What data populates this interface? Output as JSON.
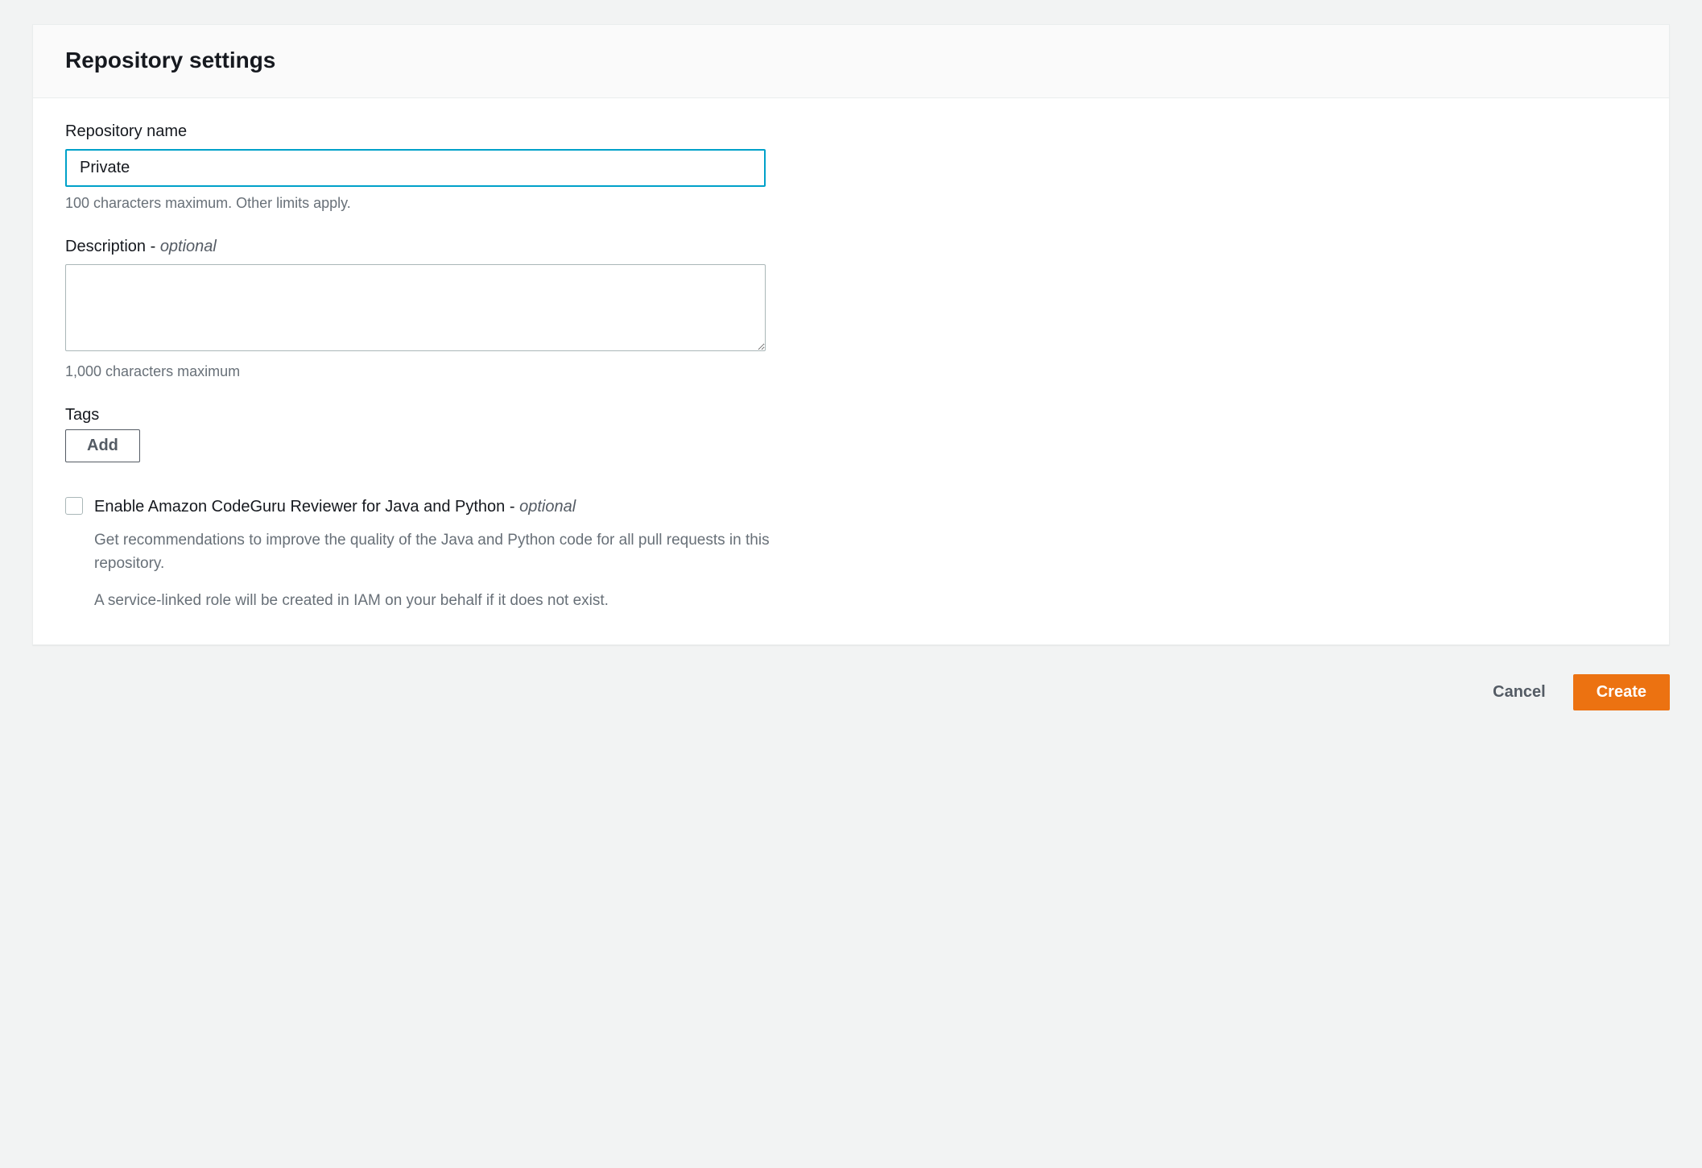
{
  "panel": {
    "title": "Repository settings"
  },
  "repositoryName": {
    "label": "Repository name",
    "value": "Private",
    "help": "100 characters maximum. Other limits apply."
  },
  "description": {
    "label": "Description - ",
    "optional": "optional",
    "value": "",
    "help": "1,000 characters maximum"
  },
  "tags": {
    "label": "Tags",
    "addButton": "Add"
  },
  "codeguru": {
    "label": "Enable Amazon CodeGuru Reviewer for Java and Python - ",
    "optional": "optional",
    "desc1": "Get recommendations to improve the quality of the Java and Python code for all pull requests in this repository.",
    "desc2": "A service-linked role will be created in IAM on your behalf if it does not exist."
  },
  "footer": {
    "cancel": "Cancel",
    "create": "Create"
  }
}
